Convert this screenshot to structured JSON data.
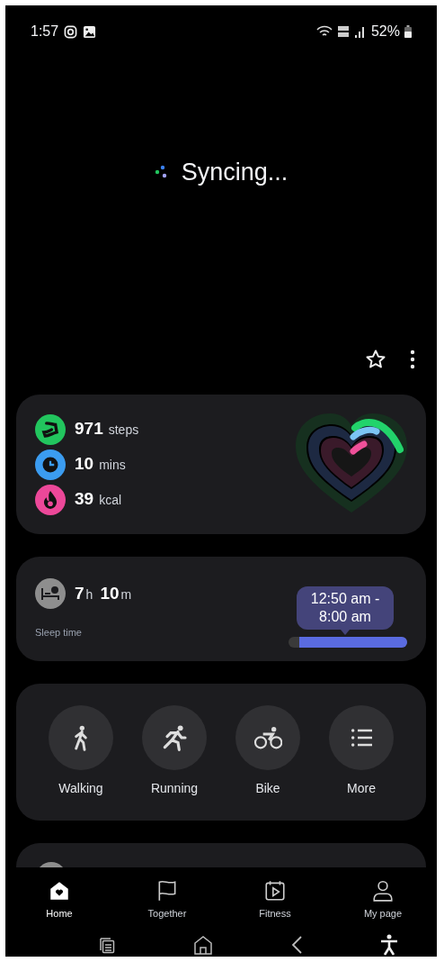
{
  "status_bar": {
    "time": "1:57",
    "battery": "52%"
  },
  "sync": {
    "label": "Syncing..."
  },
  "activity": [
    {
      "kind": "steps",
      "value": "971",
      "unit": "steps",
      "color": "#22c55e"
    },
    {
      "kind": "time",
      "value": "10",
      "unit": "mins",
      "color": "#3b9cf0"
    },
    {
      "kind": "calories",
      "value": "39",
      "unit": "kcal",
      "color": "#ec4899"
    }
  ],
  "sleep": {
    "hours": "7",
    "hours_unit": "h",
    "minutes": "10",
    "minutes_unit": "m",
    "label": "Sleep time",
    "range": "12:50 am -\n8:00 am"
  },
  "workouts": [
    {
      "kind": "walking",
      "label": "Walking"
    },
    {
      "kind": "running",
      "label": "Running"
    },
    {
      "kind": "bike",
      "label": "Bike"
    },
    {
      "kind": "more",
      "label": "More"
    }
  ],
  "tabs": [
    {
      "kind": "home",
      "label": "Home",
      "selected": true
    },
    {
      "kind": "together",
      "label": "Together",
      "selected": false
    },
    {
      "kind": "fitness",
      "label": "Fitness",
      "selected": false
    },
    {
      "kind": "mypage",
      "label": "My page",
      "selected": false
    }
  ]
}
